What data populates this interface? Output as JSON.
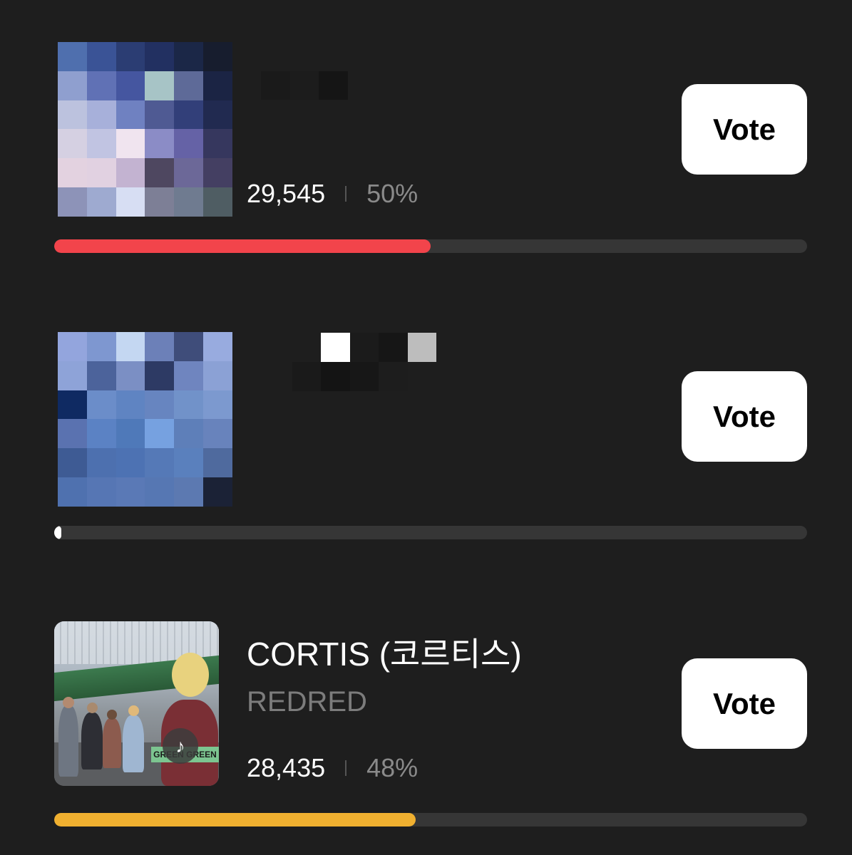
{
  "items": [
    {
      "title": "",
      "subtitle": "",
      "count": "29,545",
      "percent": "50%",
      "vote_label": "Vote",
      "progress": 0.5,
      "bar_color": "#f2444b",
      "thumbnail_icon": "pixelated-thumbnail"
    },
    {
      "title": "",
      "subtitle": "",
      "count": "",
      "percent": "",
      "vote_label": "Vote",
      "progress": 0.0,
      "bar_color": "#ffffff",
      "thumbnail_icon": "pixelated-thumbnail"
    },
    {
      "title": "CORTIS (코르티스)",
      "subtitle": "REDRED",
      "count": "28,435",
      "percent": "48%",
      "vote_label": "Vote",
      "progress": 0.48,
      "bar_color": "#f0b030",
      "thumbnail_icon": "album-photo",
      "photo_sign_text": "GREEN GREEN"
    }
  ],
  "colors": {
    "background": "#1e1e1e",
    "track": "#363636",
    "button_bg": "#ffffff",
    "button_text": "#000000"
  }
}
